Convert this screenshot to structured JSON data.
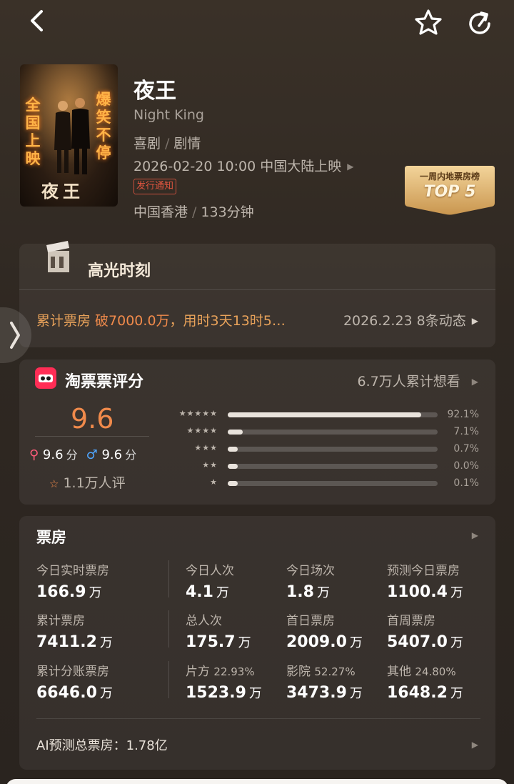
{
  "movie": {
    "title": "夜王",
    "english_title": "Night King",
    "genres": [
      "喜剧",
      "剧情"
    ],
    "release": "2026-02-20 10:00 中国大陆上映",
    "notice": "发行通知",
    "region": "中国香港",
    "duration": "133分钟",
    "poster": {
      "left_text": "全国上映",
      "right_text": "爆笑不停",
      "title": "夜王"
    }
  },
  "badge": {
    "line1": "一周内地票房榜",
    "line2": "TOP 5"
  },
  "highlights": {
    "title": "高光时刻",
    "text_prefix": "累计票房 ",
    "text_strong": "破7000.0万",
    "text_suffix": "，用时3天13时5…",
    "date_events": "2026.2.23  8条动态"
  },
  "rating": {
    "title": "淘票票评分",
    "want": "6.7万人累计想看",
    "score": "9.6",
    "female_score": "9.6",
    "male_score": "9.6",
    "score_unit": "分",
    "review_count": "1.1万人评",
    "distribution": [
      {
        "stars": "★★★★★",
        "percent": 92.1,
        "label": "92.1%"
      },
      {
        "stars": "★★★★",
        "percent": 7.1,
        "label": "7.1%"
      },
      {
        "stars": "★★★",
        "percent": 0.7,
        "label": "0.7%"
      },
      {
        "stars": "★★",
        "percent": 0.0,
        "label": "0.0%"
      },
      {
        "stars": "★",
        "percent": 0.1,
        "label": "0.1%"
      }
    ]
  },
  "boxoffice": {
    "title": "票房",
    "unit": "万",
    "stats": [
      {
        "label": "今日实时票房",
        "value": "166.9"
      },
      {
        "label": "今日人次",
        "value": "4.1"
      },
      {
        "label": "今日场次",
        "value": "1.8"
      },
      {
        "label": "预测今日票房",
        "value": "1100.4"
      },
      {
        "label": "累计票房",
        "value": "7411.2"
      },
      {
        "label": "总人次",
        "value": "175.7"
      },
      {
        "label": "首日票房",
        "value": "2009.0"
      },
      {
        "label": "首周票房",
        "value": "5407.0"
      },
      {
        "label": "累计分账票房",
        "value": "6646.0"
      },
      {
        "label": "片方",
        "pct": "22.93%",
        "value": "1523.9"
      },
      {
        "label": "影院",
        "pct": "52.27%",
        "value": "3473.9"
      },
      {
        "label": "其他",
        "pct": "24.80%",
        "value": "1648.2"
      }
    ],
    "ai_prediction": "AI预测总票房：1.78亿"
  },
  "colors": {
    "accent": "#f08a4b",
    "background": "#2f2822",
    "female": "#ff5c7a",
    "male": "#4fa6ff"
  }
}
